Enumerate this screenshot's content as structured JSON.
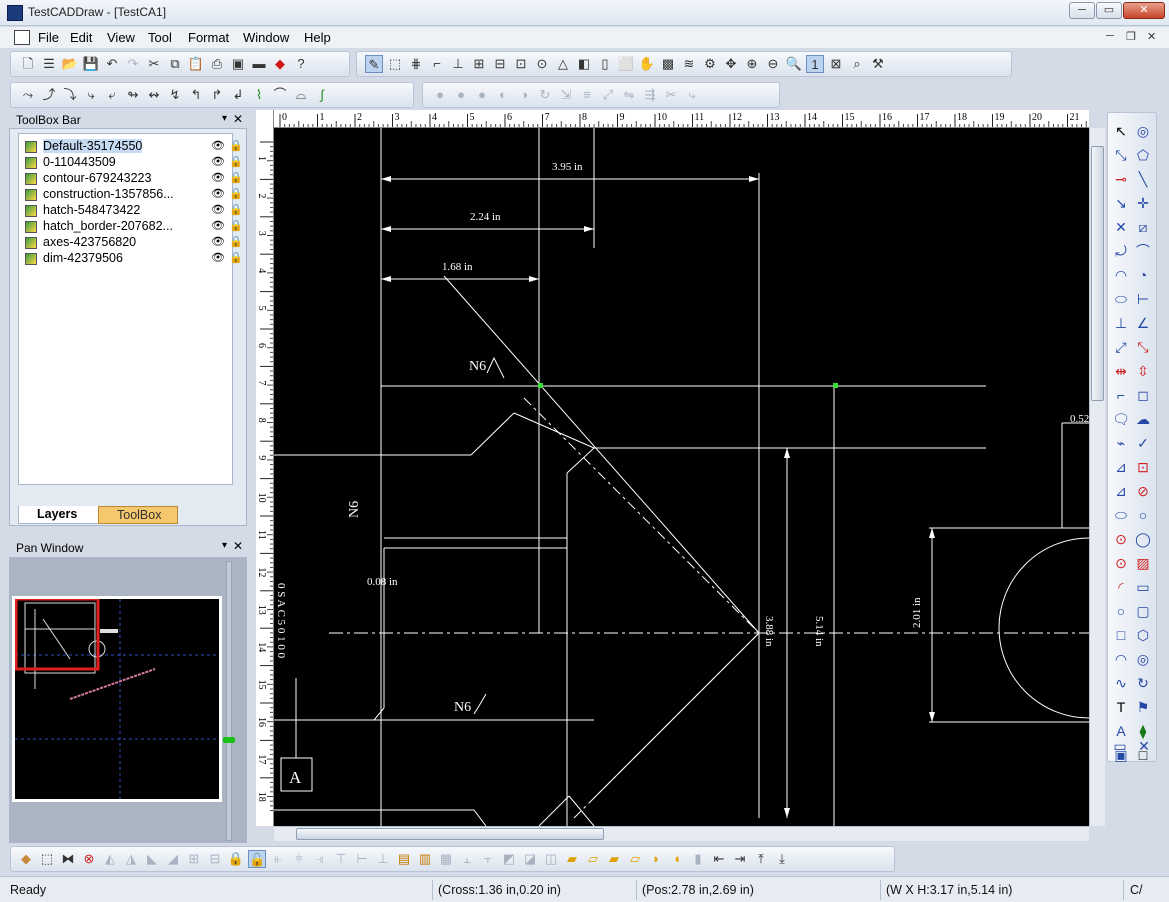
{
  "window": {
    "title": "TestCADDraw - [TestCA1]"
  },
  "menu": {
    "items": [
      "File",
      "Edit",
      "View",
      "Tool",
      "Format",
      "Window",
      "Help"
    ]
  },
  "toolbox_panel": {
    "title": "ToolBox Bar",
    "layers": [
      "Default-35174550",
      "0-110443509",
      "contour-679243223",
      "construction-1357856...",
      "hatch-548473422",
      "hatch_border-207682...",
      "axes-423756820",
      "dim-42379506"
    ],
    "tabs": {
      "layers": "Layers",
      "toolbox": "ToolBox"
    }
  },
  "pan_panel": {
    "title": "Pan Window"
  },
  "ruler": {
    "top_labels": [
      "0",
      "1",
      "2",
      "3",
      "4",
      "5",
      "6",
      "7",
      "8",
      "9",
      "10",
      "11",
      "12",
      "13",
      "14",
      "15",
      "16",
      "17",
      "18",
      "19",
      "20",
      "21"
    ],
    "left_labels": [
      "1",
      "2",
      "3",
      "4",
      "5",
      "6",
      "7",
      "8",
      "9",
      "10",
      "11",
      "12",
      "13",
      "14",
      "15",
      "16",
      "17",
      "18"
    ]
  },
  "drawing": {
    "dims": {
      "d1": "3.95 in",
      "d2": "2.24 in",
      "d3": "1.68 in",
      "d4": "0.08 in",
      "d5": "3.88 in",
      "d6": "5.14 in",
      "d7": "2.01 in",
      "d8": "0.52"
    },
    "finish": {
      "a": "N6",
      "b": "N6",
      "c": "N6"
    },
    "section_label": "A",
    "vertical_note": "0 S A C 5 0 1 0 0"
  },
  "status": {
    "ready": "Ready",
    "cross": "(Cross:1.36 in,0.20 in)",
    "pos": "(Pos:2.78 in,2.69 in)",
    "wh": "(W X H:3.17 in,5.14 in)",
    "end": "C/"
  }
}
